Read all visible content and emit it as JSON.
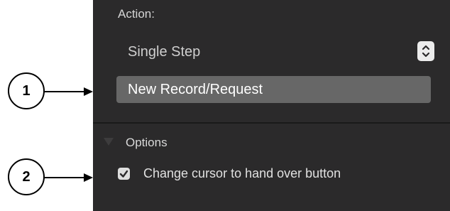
{
  "panel": {
    "action_label": "Action:",
    "step_popup": {
      "selected": "Single Step"
    },
    "record_field": {
      "value": "New Record/Request"
    },
    "options_label": "Options",
    "checkbox": {
      "label": "Change cursor to hand over button",
      "checked": true
    }
  },
  "callouts": [
    {
      "number": "1"
    },
    {
      "number": "2"
    }
  ],
  "colors": {
    "panel_bg": "#2b2a2b",
    "field_bg": "#676767",
    "text_light": "#d6d6d6"
  }
}
